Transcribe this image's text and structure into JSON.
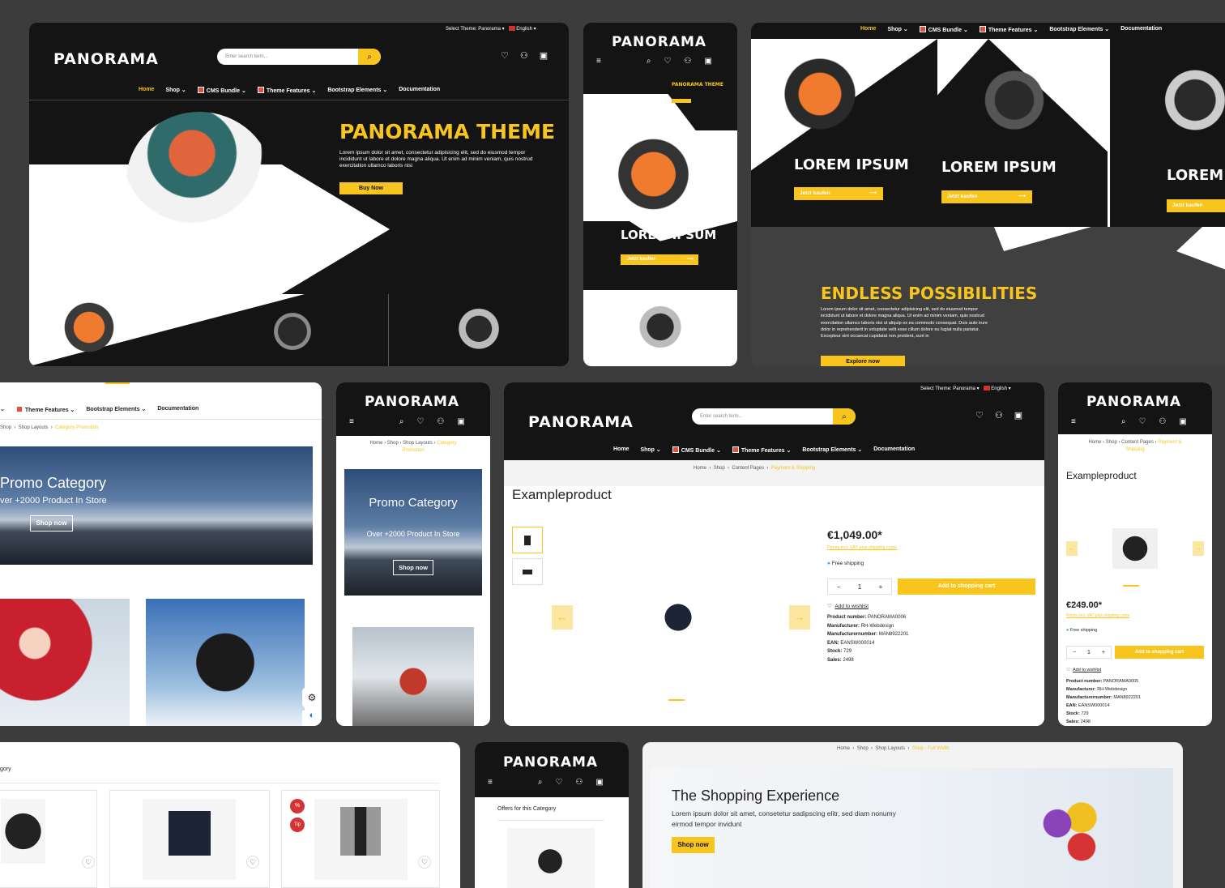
{
  "brand": {
    "logo": "PANORAMA",
    "accent": "#f7c51e",
    "dark": "#141414"
  },
  "topbar": {
    "theme_select": "Select Theme: Panorama",
    "language": "English"
  },
  "search": {
    "placeholder": "Enter search term..."
  },
  "nav": {
    "home": "Home",
    "shop": "Shop",
    "cms": "CMS Bundle",
    "theme_features": "Theme Features",
    "bootstrap": "Bootstrap Elements",
    "documentation": "Documentation"
  },
  "cart_count": "0",
  "hero": {
    "title": "PANORAMA THEME",
    "text": "Lorem ipsum dolor sit amet, consectetur adipisicing elit, sed do eiusmod tempor incididunt ut labore et dolore magna aliqua. Ut enim ad minim veniam, quis nostrud exercitation ullamco laboris nisi",
    "button": "Buy Now"
  },
  "tiles": {
    "lorem": "LOREM IPSUM",
    "button": "Jetzt kaufen"
  },
  "endless": {
    "title": "ENDLESS POSSIBILITIES",
    "text": "Lorem ipsum dolor sit amet, consectetur adipisicing elit, sed do eiusmod tempor incididunt ut labore et dolore magna aliqua. Ut enim ad minim veniam, quis nostrud exercitation ullamco laboris nisi ut aliquip ex ea commodo consequat. Duis aute irure dolor in reprehenderit in voluptate velit esse cillum dolore eu fugiat nulla pariatur. Excepteur sint occaecat cupidatat non proident, sunt in",
    "button": "Explore now"
  },
  "promo": {
    "crumb_shop": "Shop",
    "crumb_layouts": "Shop Layouts",
    "crumb_current": "Category Promotion",
    "title": "Promo Category",
    "sub": "ver +2000 Product In Store",
    "mobile_title": "Promo Category",
    "mobile_sub": "Over +2000 Product In Store",
    "button": "Shop now",
    "crumb_home": "Home"
  },
  "product": {
    "crumb_home": "Home",
    "crumb_shop": "Shop",
    "crumb_content": "Content Pages",
    "crumb_current": "Payment & Shipping",
    "name": "Exampleproduct",
    "price": "€1,049.00*",
    "price_mobile": "€249.00*",
    "vat": "Prices incl. VAT plus shipping costs",
    "shipping": "Free shipping",
    "qty": "1",
    "add_cart": "Add to shopping cart",
    "wishlist": "Add to wishlist",
    "pn_label": "Product number:",
    "pn": "PANORAMA0006",
    "pn_mobile": "PANORAMA0005",
    "mf_label": "Manufacturer:",
    "mf": "RH-Webdesign",
    "mfn_label": "Manufacturernumber:",
    "mfn": "MAN8922201",
    "ean_label": "EAN:",
    "ean": "EANSW000014",
    "stock_label": "Stock:",
    "stock": "729",
    "sales_label": "Sales:",
    "sales": "2498"
  },
  "listing": {
    "category": "gory",
    "badge_sale": "%",
    "badge_tip": "Tip",
    "offers": "Offers for this Category"
  },
  "shopping": {
    "crumb_home": "Home",
    "crumb_shop": "Shop",
    "crumb_layouts": "Shop Layouts",
    "crumb_current": "Shop - Full Width",
    "title": "The Shopping Experience",
    "text": "Lorem ipsum dolor sit amet, consetetur sadipscing elitr, sed diam nonumy eirmod tempor invidunt",
    "button": "Shop now"
  },
  "icons": [
    "heart-icon",
    "user-icon",
    "cart-icon",
    "search-icon",
    "menu-icon",
    "gear-icon",
    "arrow-left-icon",
    "arrow-right-icon"
  ]
}
